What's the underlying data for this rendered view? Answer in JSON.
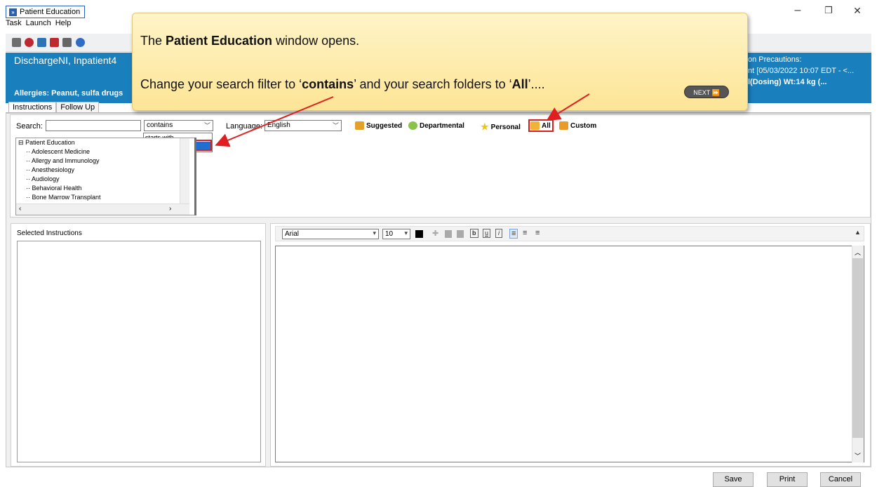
{
  "window": {
    "title": "Patient Education",
    "app_icon_glyph": "»",
    "minimize_glyph": "–",
    "restore_glyph": "❐",
    "close_glyph": "✕"
  },
  "menu": [
    "Task",
    "Launch",
    "Help"
  ],
  "toolbar_icons": [
    {
      "name": "toolbar-document-icon",
      "color": "#6e6e6e"
    },
    {
      "name": "toolbar-heart-icon",
      "color": "#c0282f"
    },
    {
      "name": "toolbar-book-icon",
      "color": "#2d73b8"
    },
    {
      "name": "toolbar-edit-icon",
      "color": "#c0282f"
    },
    {
      "name": "toolbar-link-icon",
      "color": "#666666"
    },
    {
      "name": "toolbar-help-icon",
      "color": "#2f6cc4"
    }
  ],
  "banner": {
    "patient_name": "DischargeNI, Inpatient4",
    "allergies": "Allergies: Peanut, sulfa drugs",
    "precaution_line1": "on Precautions:",
    "precaution_line2": "nt [05/03/2022 10:07 EDT - <...",
    "precaution_line3": "l(Dosing) Wt:14 kg         (..."
  },
  "tabs": [
    "Instructions",
    "Follow Up"
  ],
  "search": {
    "label": "Search:",
    "value": "",
    "filter_value": "contains",
    "filter_options": [
      "starts with",
      "contains"
    ]
  },
  "language": {
    "label": "Language:",
    "value": "English"
  },
  "folders": [
    {
      "name": "folder-suggested",
      "label": "Suggested",
      "color": "#e2a12b"
    },
    {
      "name": "folder-departmental",
      "label": "Departmental",
      "color": "#8ac24a"
    },
    {
      "name": "folder-personal",
      "label": "Personal",
      "color": "#f0c419"
    },
    {
      "name": "folder-all",
      "label": "All",
      "color": "#f0b33a"
    },
    {
      "name": "folder-custom",
      "label": "Custom",
      "color": "#e99a2a"
    }
  ],
  "tree": {
    "root": "Patient Education",
    "children": [
      "Adolescent Medicine",
      "Allergy and Immunology",
      "Anesthesiology",
      "Audiology",
      "Behavioral Health",
      "Bone Marrow Transplant"
    ]
  },
  "selected_instructions_label": "Selected Instructions",
  "editor": {
    "font": "Arial",
    "size": "10",
    "bold_glyph": "b",
    "underline_glyph": "u",
    "italic_glyph": "i",
    "collapse_glyph": "▲"
  },
  "buttons": {
    "save": "Save",
    "print": "Print",
    "cancel": "Cancel"
  },
  "callout": {
    "line1_pre": "The ",
    "line1_bold": "Patient Education",
    "line1_post": " window opens.",
    "line2_pre": "Change your search filter to ‘",
    "line2_bold1": "contains",
    "line2_mid": "’ and your search folders to ‘",
    "line2_bold2": "All",
    "line2_post": "’....",
    "next_label": "NEXT ⏩"
  },
  "colors": {
    "banner": "#1a7fbd",
    "highlight": "#d9201f",
    "callout_bg": "#fde596"
  }
}
